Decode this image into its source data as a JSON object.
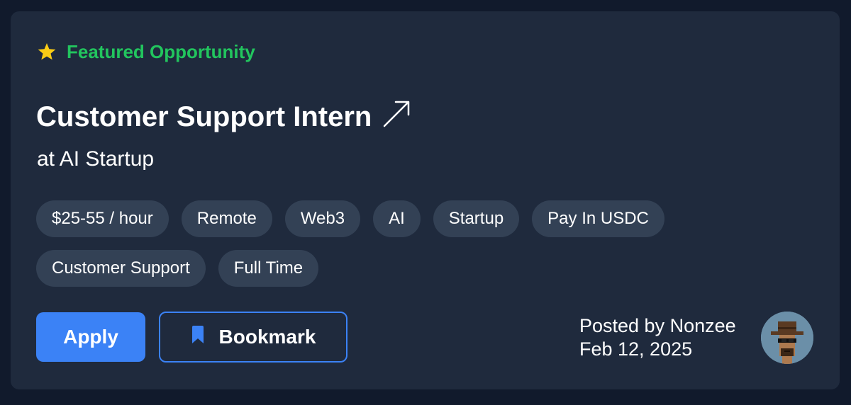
{
  "featured": {
    "label": "Featured Opportunity",
    "icon": "star-icon",
    "color": "#22c55e"
  },
  "job": {
    "title": "Customer Support Intern",
    "title_icon": "external-arrow-icon",
    "company": "at AI Startup"
  },
  "tags": [
    "$25-55 / hour",
    "Remote",
    "Web3",
    "AI",
    "Startup",
    "Pay In USDC",
    "Customer Support",
    "Full Time"
  ],
  "actions": {
    "apply_label": "Apply",
    "bookmark_label": "Bookmark",
    "bookmark_icon": "bookmark-icon",
    "accent": "#3b82f6"
  },
  "poster": {
    "posted_by": "Posted by Nonzee",
    "date": "Feb 12, 2025"
  }
}
